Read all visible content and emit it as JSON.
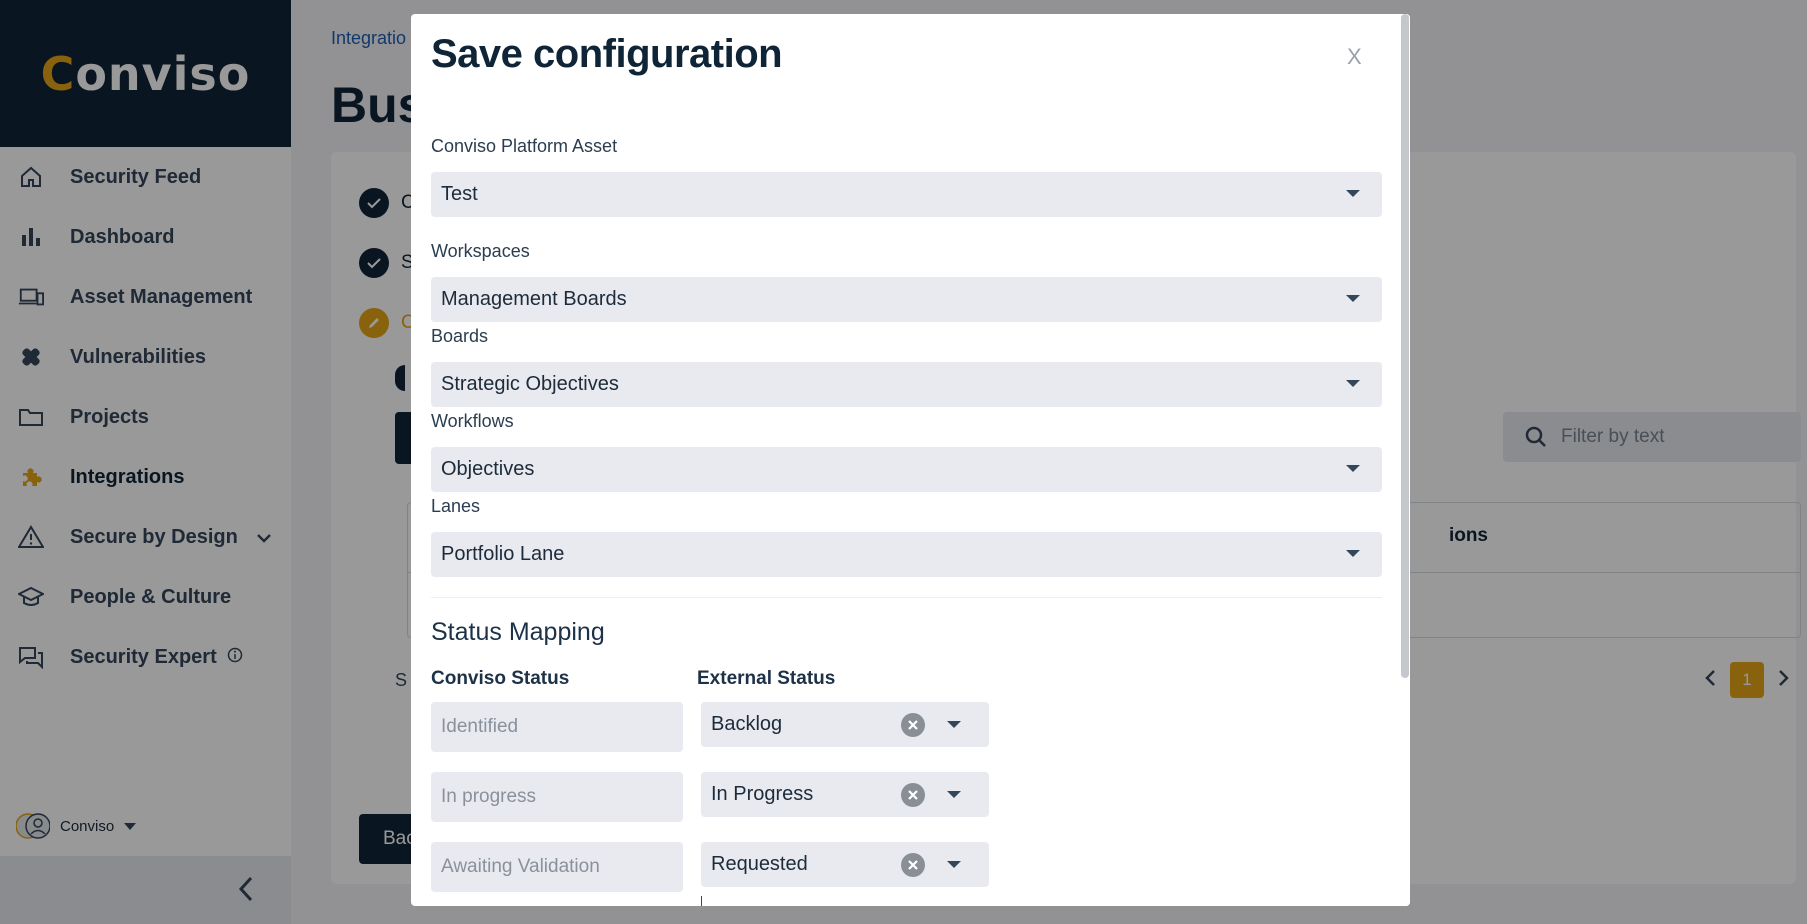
{
  "brand": {
    "logo_text_prefix": "C",
    "logo_text_rest": "onviso",
    "accent": "#e3a415",
    "dark": "#0f2537"
  },
  "sidebar": {
    "items": [
      {
        "label": "Security Feed",
        "icon": "home-icon"
      },
      {
        "label": "Dashboard",
        "icon": "bar-chart-icon"
      },
      {
        "label": "Asset Management",
        "icon": "devices-icon"
      },
      {
        "label": "Vulnerabilities",
        "icon": "bandage-icon"
      },
      {
        "label": "Projects",
        "icon": "folder-icon"
      },
      {
        "label": "Integrations",
        "icon": "puzzle-icon",
        "active": true
      },
      {
        "label": "Secure by Design",
        "icon": "warning-icon"
      },
      {
        "label": "People & Culture",
        "icon": "graduation-cap-icon"
      },
      {
        "label": "Security Expert",
        "icon": "chat-icon"
      }
    ],
    "user_name": "Conviso"
  },
  "background": {
    "breadcrumb": "Integratio",
    "page_title": "Bus",
    "steps": [
      "C",
      "S",
      "C"
    ],
    "filter_placeholder": "Filter by text",
    "table_header_actions": "ions",
    "pager_current": "1",
    "back_button": "Bac",
    "s_char": "S"
  },
  "modal": {
    "title": "Save configuration",
    "close_label": "X",
    "fields": {
      "asset": {
        "label": "Conviso Platform Asset",
        "value": "Test"
      },
      "workspaces": {
        "label": "Workspaces",
        "value": "Management Boards"
      },
      "boards": {
        "label": "Boards",
        "value": "Strategic Objectives"
      },
      "workflows": {
        "label": "Workflows",
        "value": "Objectives"
      },
      "lanes": {
        "label": "Lanes",
        "value": "Portfolio Lane"
      }
    },
    "status_mapping": {
      "title": "Status Mapping",
      "conviso_header": "Conviso Status",
      "external_header": "External Status",
      "rows": [
        {
          "conviso": "Identified",
          "external": "Backlog"
        },
        {
          "conviso": "In progress",
          "external": "In Progress"
        },
        {
          "conviso": "Awaiting Validation",
          "external": "Requested"
        }
      ]
    }
  }
}
